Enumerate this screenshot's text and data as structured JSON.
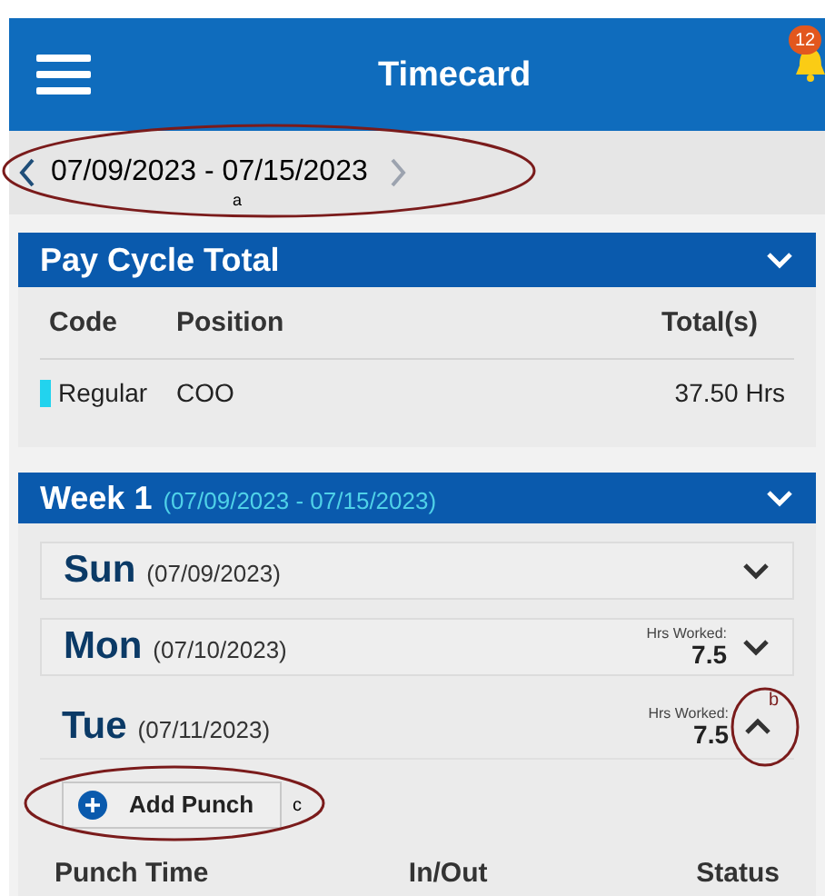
{
  "header": {
    "title": "Timecard",
    "notification_count": "12"
  },
  "date_range": {
    "label": "07/09/2023 - 07/15/2023"
  },
  "pay_cycle": {
    "title": "Pay Cycle Total",
    "expanded": true,
    "columns": [
      "Code",
      "Position",
      "Total(s)"
    ],
    "rows": [
      {
        "code": "Regular",
        "color": "#22d3ee",
        "position": "COO",
        "total": "37.50 Hrs"
      }
    ]
  },
  "week": {
    "title": "Week 1",
    "range": "(07/09/2023 - 07/15/2023)",
    "expanded": true,
    "days": [
      {
        "name": "Sun",
        "date": "(07/09/2023)",
        "expanded": false
      },
      {
        "name": "Mon",
        "date": "(07/10/2023)",
        "hours_label": "Hrs Worked:",
        "hours": "7.5",
        "expanded": false
      },
      {
        "name": "Tue",
        "date": "(07/11/2023)",
        "hours_label": "Hrs Worked:",
        "hours": "7.5",
        "expanded": true
      }
    ]
  },
  "add_punch_button": "Add Punch",
  "punch_columns": [
    "Punch Time",
    "In/Out",
    "Status"
  ],
  "annotations": [
    {
      "label": "a"
    },
    {
      "label": "b"
    },
    {
      "label": "c"
    }
  ]
}
